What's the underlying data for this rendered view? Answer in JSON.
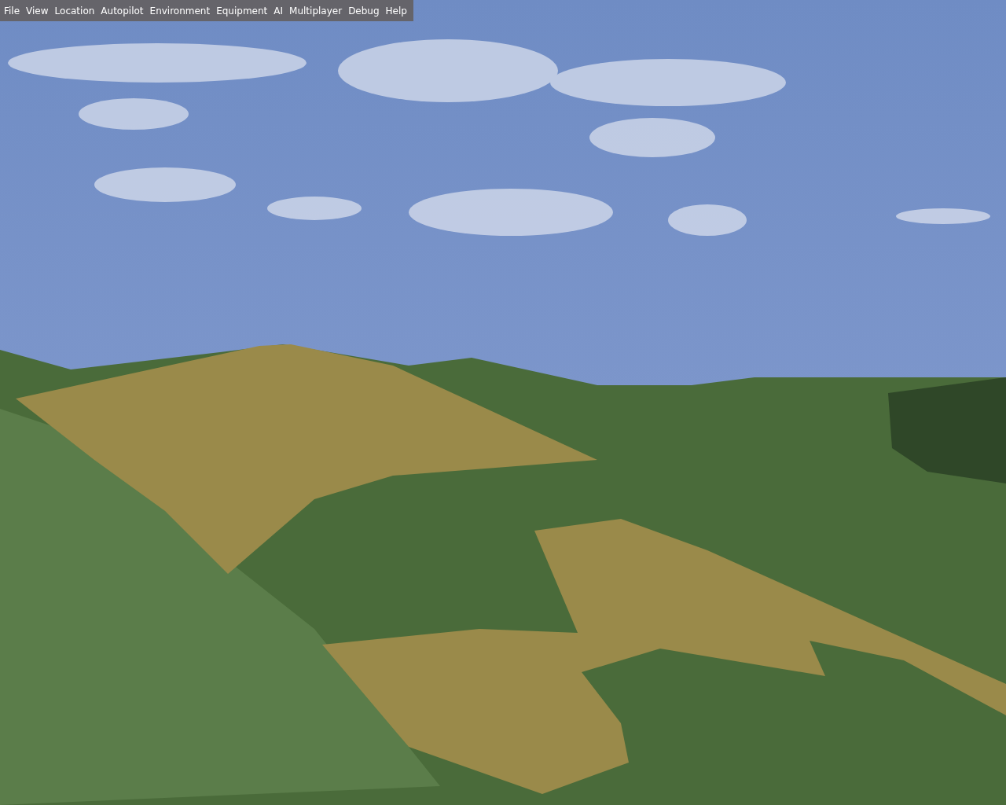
{
  "menu_bar": {
    "items": [
      {
        "label": "File"
      },
      {
        "label": "View"
      },
      {
        "label": "Location"
      },
      {
        "label": "Autopilot"
      },
      {
        "label": "Environment"
      },
      {
        "label": "Equipment"
      },
      {
        "label": "AI"
      },
      {
        "label": "Multiplayer"
      },
      {
        "label": "Debug"
      },
      {
        "label": "Help"
      }
    ]
  }
}
